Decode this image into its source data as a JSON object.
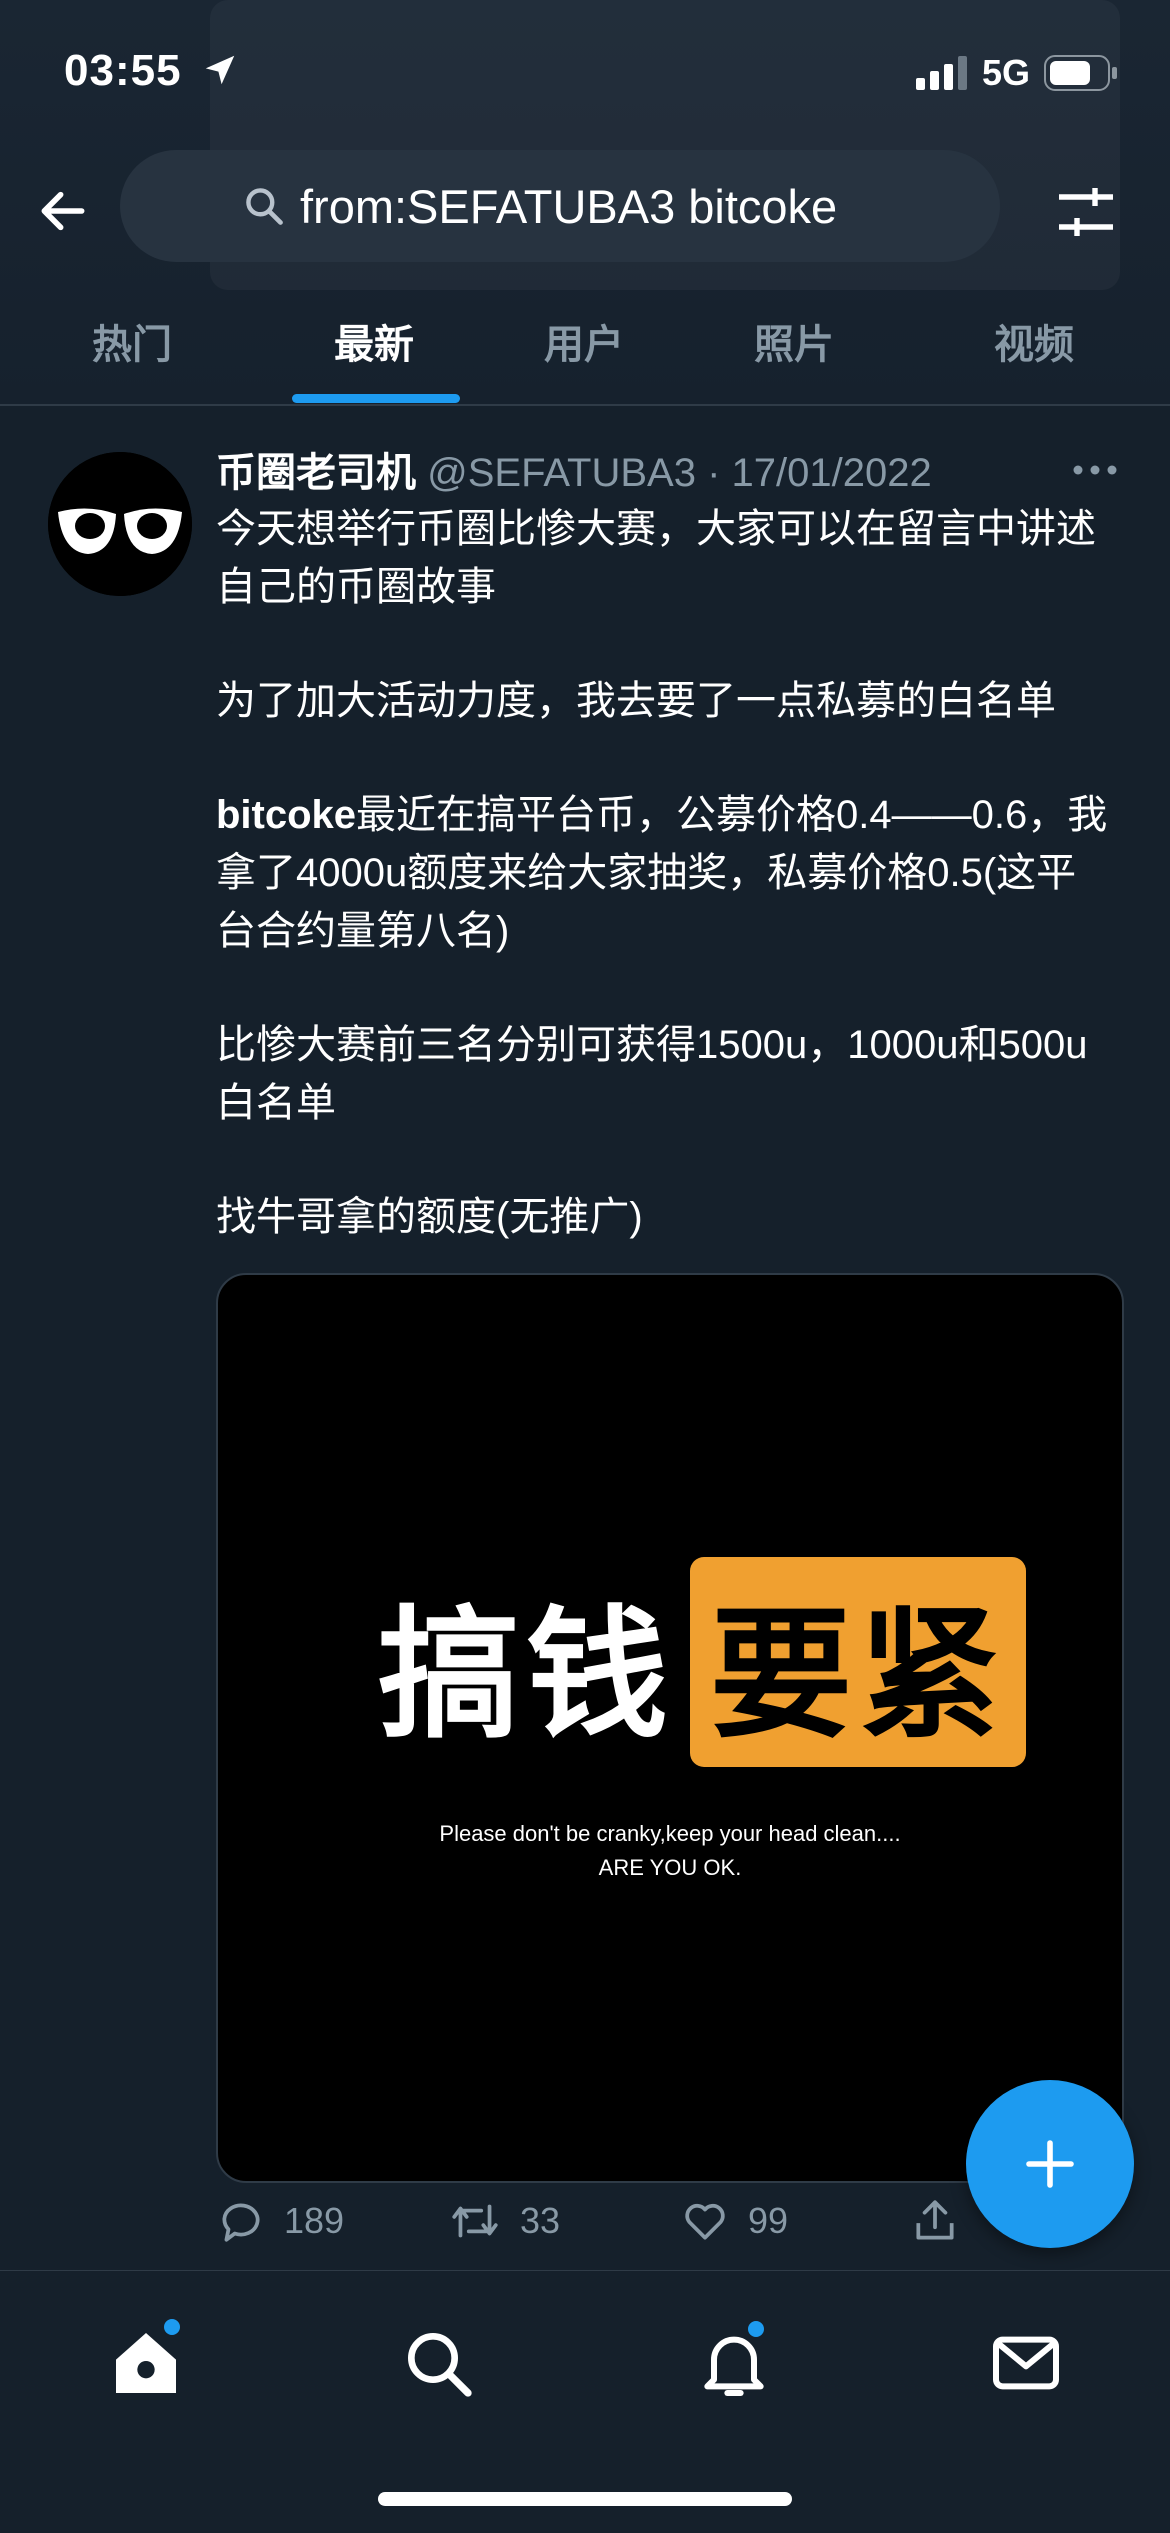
{
  "status_bar": {
    "time": "03:55",
    "network": "5G"
  },
  "search": {
    "query": "from:SEFATUBA3 bitcoke"
  },
  "tabs": [
    {
      "label": "热门"
    },
    {
      "label": "最新"
    },
    {
      "label": "用户"
    },
    {
      "label": "照片"
    },
    {
      "label": "视频"
    }
  ],
  "active_tab": "最新",
  "tweet": {
    "display_name": "币圈老司机",
    "handle": "@SEFATUBA3",
    "date": "17/01/2022",
    "meta": "@SEFATUBA3 · 17/01/2022",
    "para1": "今天想举行币圈比惨大赛，大家可以在留言中讲述自己的币圈故事",
    "para2": "为了加大活动力度，我去要了一点私募的白名单",
    "para3_bold": "bitcoke",
    "para3_rest": "最近在搞平台币，公募价格0.4——0.6，我拿了4000u额度来给大家抽奖，私募价格0.5(这平台合约量第八名)",
    "para4": "比惨大赛前三名分别可获得1500u，1000u和500u白名单",
    "para5": "找牛哥拿的额度(无推广)",
    "media": {
      "title_white": "搞钱",
      "title_boxed": "要紧",
      "subtitle_line1": "Please don't be cranky,keep your head clean....",
      "subtitle_line2": "ARE YOU OK."
    },
    "stats": {
      "replies": "189",
      "retweets": "33",
      "likes": "99"
    }
  },
  "icons": {
    "back": "arrow-left-icon",
    "search": "search-icon",
    "filter": "sliders-icon",
    "reply": "comment-icon",
    "retweet": "retweet-icon",
    "like": "heart-icon",
    "share": "share-icon",
    "compose": "plus-icon",
    "home": "home-icon",
    "explore": "search-icon",
    "notifications": "bell-icon",
    "messages": "mail-icon"
  },
  "colors": {
    "accent": "#1d9bf0",
    "background": "#15202b",
    "secondary_text": "#8899a6",
    "media_highlight": "#f0a030"
  }
}
